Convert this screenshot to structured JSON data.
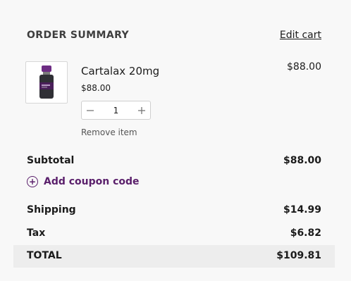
{
  "header": {
    "title": "ORDER SUMMARY",
    "edit_label": "Edit cart"
  },
  "item": {
    "name": "Cartalax 20mg",
    "unit_price": "$88.00",
    "line_price": "$88.00",
    "quantity": "1",
    "remove_label": "Remove item",
    "image_icon": "product-vial-icon"
  },
  "summary": {
    "subtotal_label": "Subtotal",
    "subtotal_value": "$88.00",
    "coupon_label": "Add coupon code",
    "shipping_label": "Shipping",
    "shipping_value": "$14.99",
    "tax_label": "Tax",
    "tax_value": "$6.82",
    "total_label": "TOTAL",
    "total_value": "$109.81"
  },
  "colors": {
    "accent": "#5a1f6b",
    "total_band": "#ededed"
  }
}
